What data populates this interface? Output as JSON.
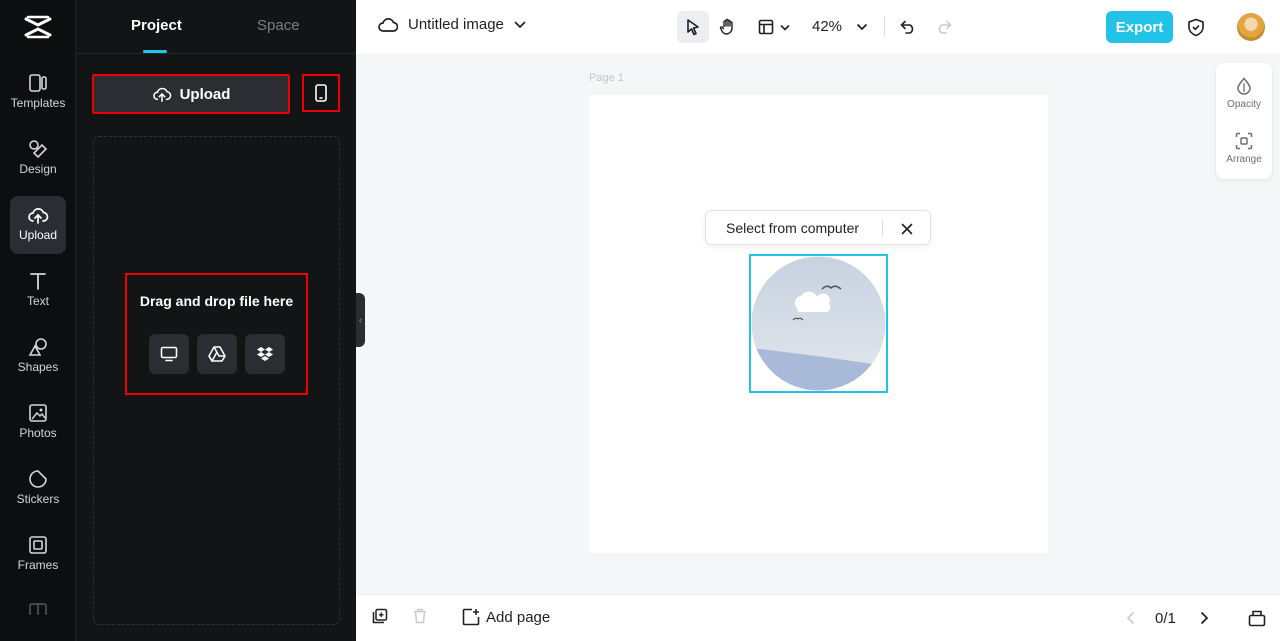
{
  "rail": {
    "items": [
      {
        "label": "Templates",
        "icon": "templates-icon"
      },
      {
        "label": "Design",
        "icon": "design-icon"
      },
      {
        "label": "Upload",
        "icon": "upload-cloud-icon",
        "active": true
      },
      {
        "label": "Text",
        "icon": "text-icon"
      },
      {
        "label": "Shapes",
        "icon": "shapes-icon"
      },
      {
        "label": "Photos",
        "icon": "photos-icon"
      },
      {
        "label": "Stickers",
        "icon": "stickers-icon"
      },
      {
        "label": "Frames",
        "icon": "frames-icon"
      }
    ]
  },
  "panel": {
    "tabs": [
      {
        "label": "Project",
        "active": true
      },
      {
        "label": "Space",
        "active": false
      }
    ],
    "upload_button": "Upload",
    "dropzone": {
      "title": "Drag and drop file here",
      "sources": [
        "computer-icon",
        "google-drive-icon",
        "dropbox-icon"
      ]
    }
  },
  "topbar": {
    "title": "Untitled image",
    "zoom": "42%",
    "export_label": "Export"
  },
  "canvas": {
    "page_label": "Page 1",
    "popup_label": "Select from computer"
  },
  "side_tools": [
    {
      "label": "Opacity",
      "icon": "opacity-icon"
    },
    {
      "label": "Arrange",
      "icon": "arrange-icon"
    }
  ],
  "bottombar": {
    "add_page": "Add page",
    "page_count": "0/1"
  },
  "colors": {
    "accent": "#22c3e6",
    "highlight_border": "#e00000",
    "rail_bg": "#0d0e10",
    "panel_bg": "#131416"
  }
}
